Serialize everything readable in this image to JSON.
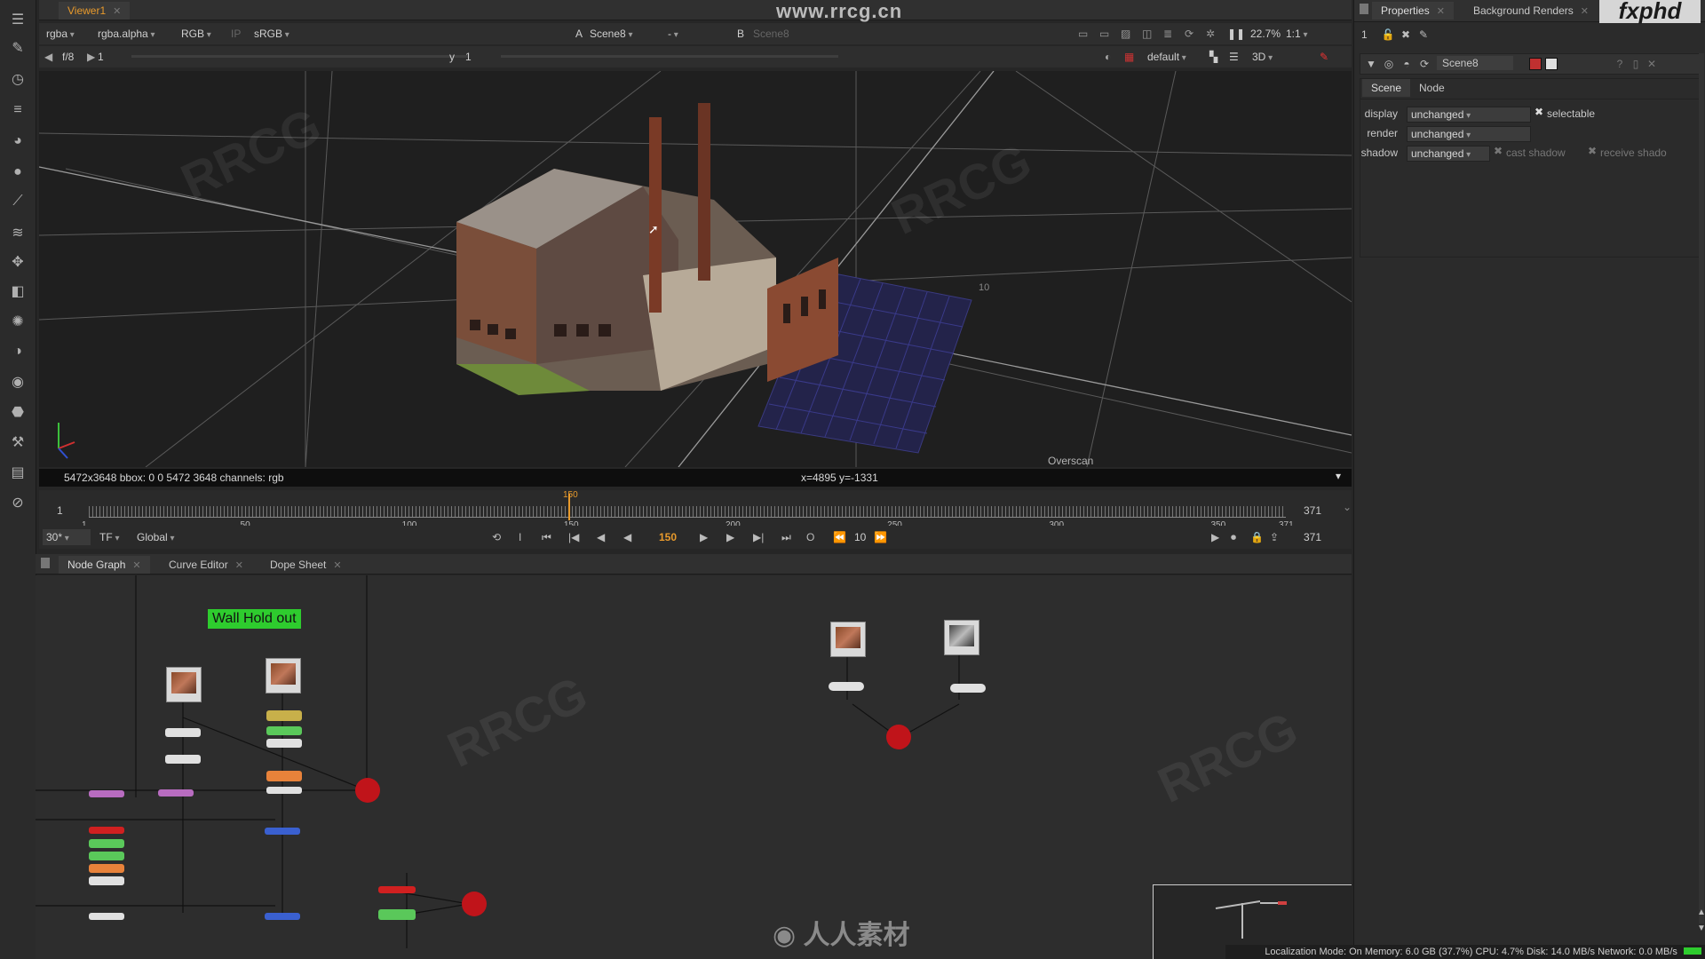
{
  "viewer_tab": {
    "label": "Viewer1",
    "close": "✕"
  },
  "viewer_controls": {
    "channels": "rgba",
    "alpha": "rgba.alpha",
    "colorspace": "RGB",
    "ip": "IP",
    "lut": "sRGB",
    "a_label": "A",
    "a_input": "Scene8",
    "dash": "-",
    "b_label": "B",
    "b_input": "Scene8",
    "zoom": "22.7%",
    "ratio": "1:1",
    "fstop": "f/8",
    "frame_field": "1",
    "y_label": "y",
    "y_value": "1",
    "view_mode": "default",
    "dim": "3D"
  },
  "watermark_url": "www.rrcg.cn",
  "viewer": {
    "overscan": "Overscan",
    "grid_label": "10"
  },
  "info_bar": {
    "format": "5472x3648  bbox: 0 0 5472 3648 channels: rgb",
    "coords": "x=4895 y=-1331"
  },
  "timeline": {
    "start": "1",
    "end": "371",
    "ticks": [
      "1",
      "50",
      "100",
      "150",
      "200",
      "250",
      "300",
      "350",
      "371"
    ],
    "current": "150",
    "fps": "30*",
    "tf": "TF",
    "global": "Global",
    "frame_display": "150",
    "step": "10",
    "end_frame": "371"
  },
  "panel_tabs": [
    {
      "label": "Node Graph"
    },
    {
      "label": "Curve Editor"
    },
    {
      "label": "Dope Sheet"
    }
  ],
  "backdrop_label": "Wall Hold out",
  "properties": {
    "tabs": [
      "Properties",
      "Background Renders"
    ],
    "brand": "fxphd",
    "node_count": "1",
    "node_name": "Scene8",
    "subtabs": [
      "Scene",
      "Node"
    ],
    "display_label": "display",
    "display_value": "unchanged",
    "selectable": "selectable",
    "render_label": "render",
    "render_value": "unchanged",
    "shadow_label": "shadow",
    "shadow_value": "unchanged",
    "cast_shadow": "cast shadow",
    "receive_shadow": "receive shado"
  },
  "status_bar": "Localization Mode: On  Memory: 6.0 GB (37.7%)  CPU: 4.7%  Disk: 14.0 MB/s  Network: 0.0 MB/s",
  "colors": {
    "accent": "#e89a2c",
    "backdrop": "#2ecc2e",
    "viewer_bg": "#1f1f1f",
    "node_red": "#c0141a"
  }
}
